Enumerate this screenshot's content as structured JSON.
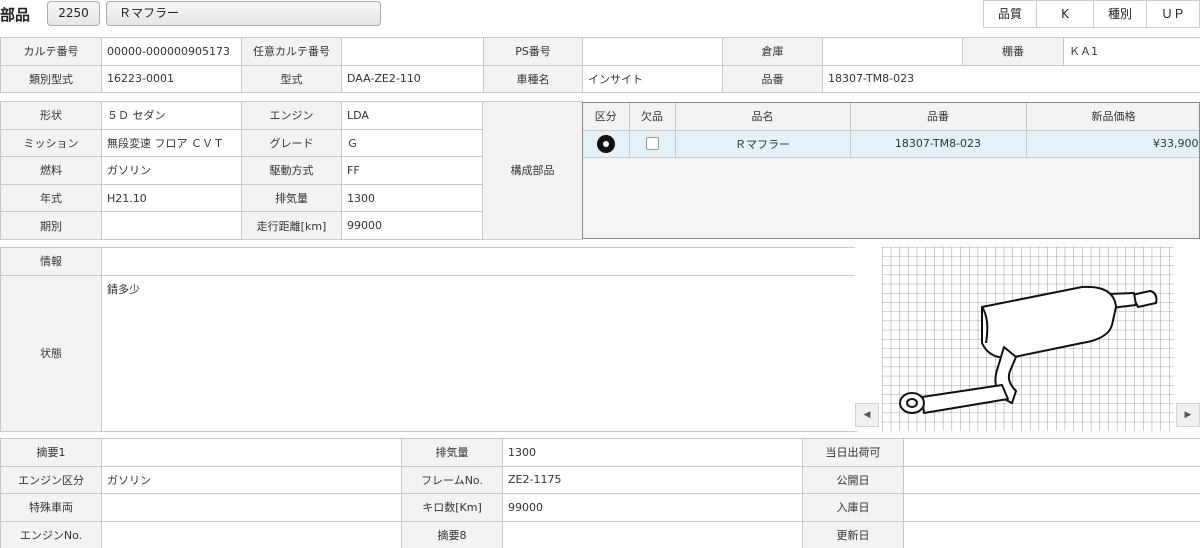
{
  "header": {
    "title": "部品",
    "code": "2250",
    "part_name": "Ｒマフラー",
    "quality_label": "品質",
    "quality_value": "K",
    "type_label": "種別",
    "type_value": "ＵＰ"
  },
  "top": {
    "karte_label": "カルテ番号",
    "karte_value": "00000-000000905173",
    "opt_karte_label": "任意カルテ番号",
    "opt_karte_value": "",
    "ps_label": "PS番号",
    "ps_value": "",
    "warehouse_label": "倉庫",
    "warehouse_value": "",
    "shelf_label": "棚番",
    "shelf_value": "ＫＡ1",
    "class_model_label": "類別型式",
    "class_model_value": "16223-0001",
    "model_label": "型式",
    "model_value": "DAA-ZE2-110",
    "car_name_label": "車種名",
    "car_name_value": "インサイト",
    "part_no_label": "品番",
    "part_no_value": "18307-TM8-023"
  },
  "spec": {
    "shape_label": "形状",
    "shape_value": "５Ｄ セダン",
    "engine_label": "エンジン",
    "engine_value": "LDA",
    "mission_label": "ミッション",
    "mission_value": "無段変速 フロア ＣＶＴ",
    "grade_label": "グレード",
    "grade_value": "Ｇ",
    "fuel_label": "燃料",
    "fuel_value": "ガソリン",
    "drive_label": "駆動方式",
    "drive_value": "FF",
    "year_label": "年式",
    "year_value": "H21.10",
    "displacement_label": "排気量",
    "displacement_value": "1300",
    "period_label": "期別",
    "period_value": "",
    "mileage_label": "走行距離[km]",
    "mileage_value": "99000",
    "component_label": "構成部品"
  },
  "parts_list": {
    "headers": [
      "区分",
      "欠品",
      "品名",
      "品番",
      "新品価格"
    ],
    "rows": [
      {
        "name": "Ｒマフラー",
        "number": "18307-TM8-023",
        "price": "¥33,900"
      }
    ]
  },
  "info": {
    "info_label": "情報",
    "info_value": "",
    "state_label": "状態",
    "state_value": "錆多少"
  },
  "bottom": {
    "summary1_label": "摘要1",
    "summary1_value": "",
    "displacement_label": "排気量",
    "displacement_value": "1300",
    "same_day_label": "当日出荷可",
    "same_day_value": "",
    "engine_type_label": "エンジン区分",
    "engine_type_value": "ガソリン",
    "frame_label": "フレームNo.",
    "frame_value": "ZE2-1175",
    "public_date_label": "公開日",
    "public_date_value": "",
    "special_label": "特殊車両",
    "special_value": "",
    "km_label": "キロ数[Km]",
    "km_value": "99000",
    "stock_date_label": "入庫日",
    "stock_date_value": "",
    "engine_no_label": "エンジンNo.",
    "engine_no_value": "",
    "summary8_label": "摘要8",
    "summary8_value": "",
    "update_label": "更新日",
    "update_value": ""
  },
  "icons": {
    "category": "disc-icon",
    "scroll_left": "arrow-left-icon",
    "scroll_right": "arrow-right-icon"
  }
}
